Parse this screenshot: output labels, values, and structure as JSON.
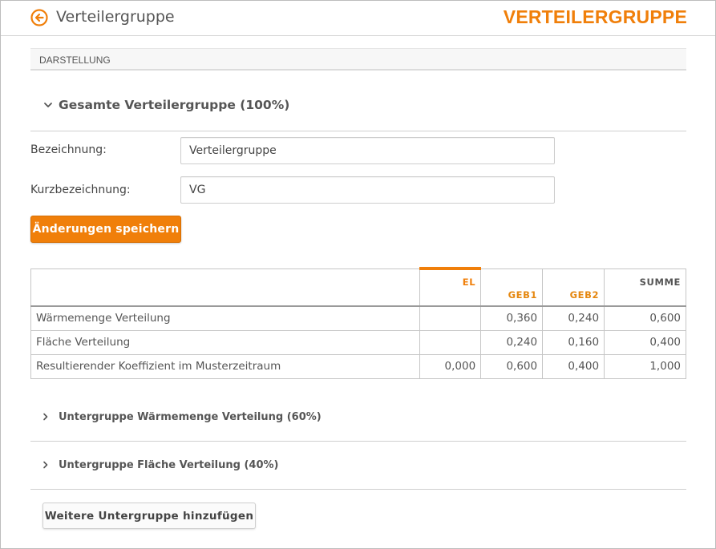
{
  "header": {
    "title": "Verteilergruppe",
    "brand": "VERTEILERGRUPPE",
    "back_icon": "arrow-left-circle-icon",
    "accent_color": "#f07f0a"
  },
  "section": {
    "label": "DARSTELLUNG"
  },
  "group": {
    "title": "Gesamte Verteilergruppe (100%)",
    "expanded": true
  },
  "form": {
    "bezeichnung_label": "Bezeichnung:",
    "bezeichnung_value": "Verteilergruppe",
    "kurz_label": "Kurzbezeichnung:",
    "kurz_value": "VG",
    "save_label": "Änderungen speichern"
  },
  "table": {
    "columns": [
      "",
      "EL",
      "GEB1",
      "GEB2",
      "SUMME"
    ],
    "rows": [
      {
        "label": "Wärmemenge Verteilung",
        "values": [
          "",
          "0,360",
          "0,240",
          "0,600"
        ]
      },
      {
        "label": "Fläche Verteilung",
        "values": [
          "",
          "0,240",
          "0,160",
          "0,400"
        ]
      },
      {
        "label": "Resultierender Koeffizient im Musterzeitraum",
        "values": [
          "0,000",
          "0,600",
          "0,400",
          "1,000"
        ]
      }
    ]
  },
  "subgroups": [
    {
      "label": "Untergruppe Wärmemenge Verteilung (60%)"
    },
    {
      "label": "Untergruppe Fläche Verteilung (40%)"
    }
  ],
  "add_button": {
    "label": "Weitere Untergruppe hinzufügen"
  }
}
